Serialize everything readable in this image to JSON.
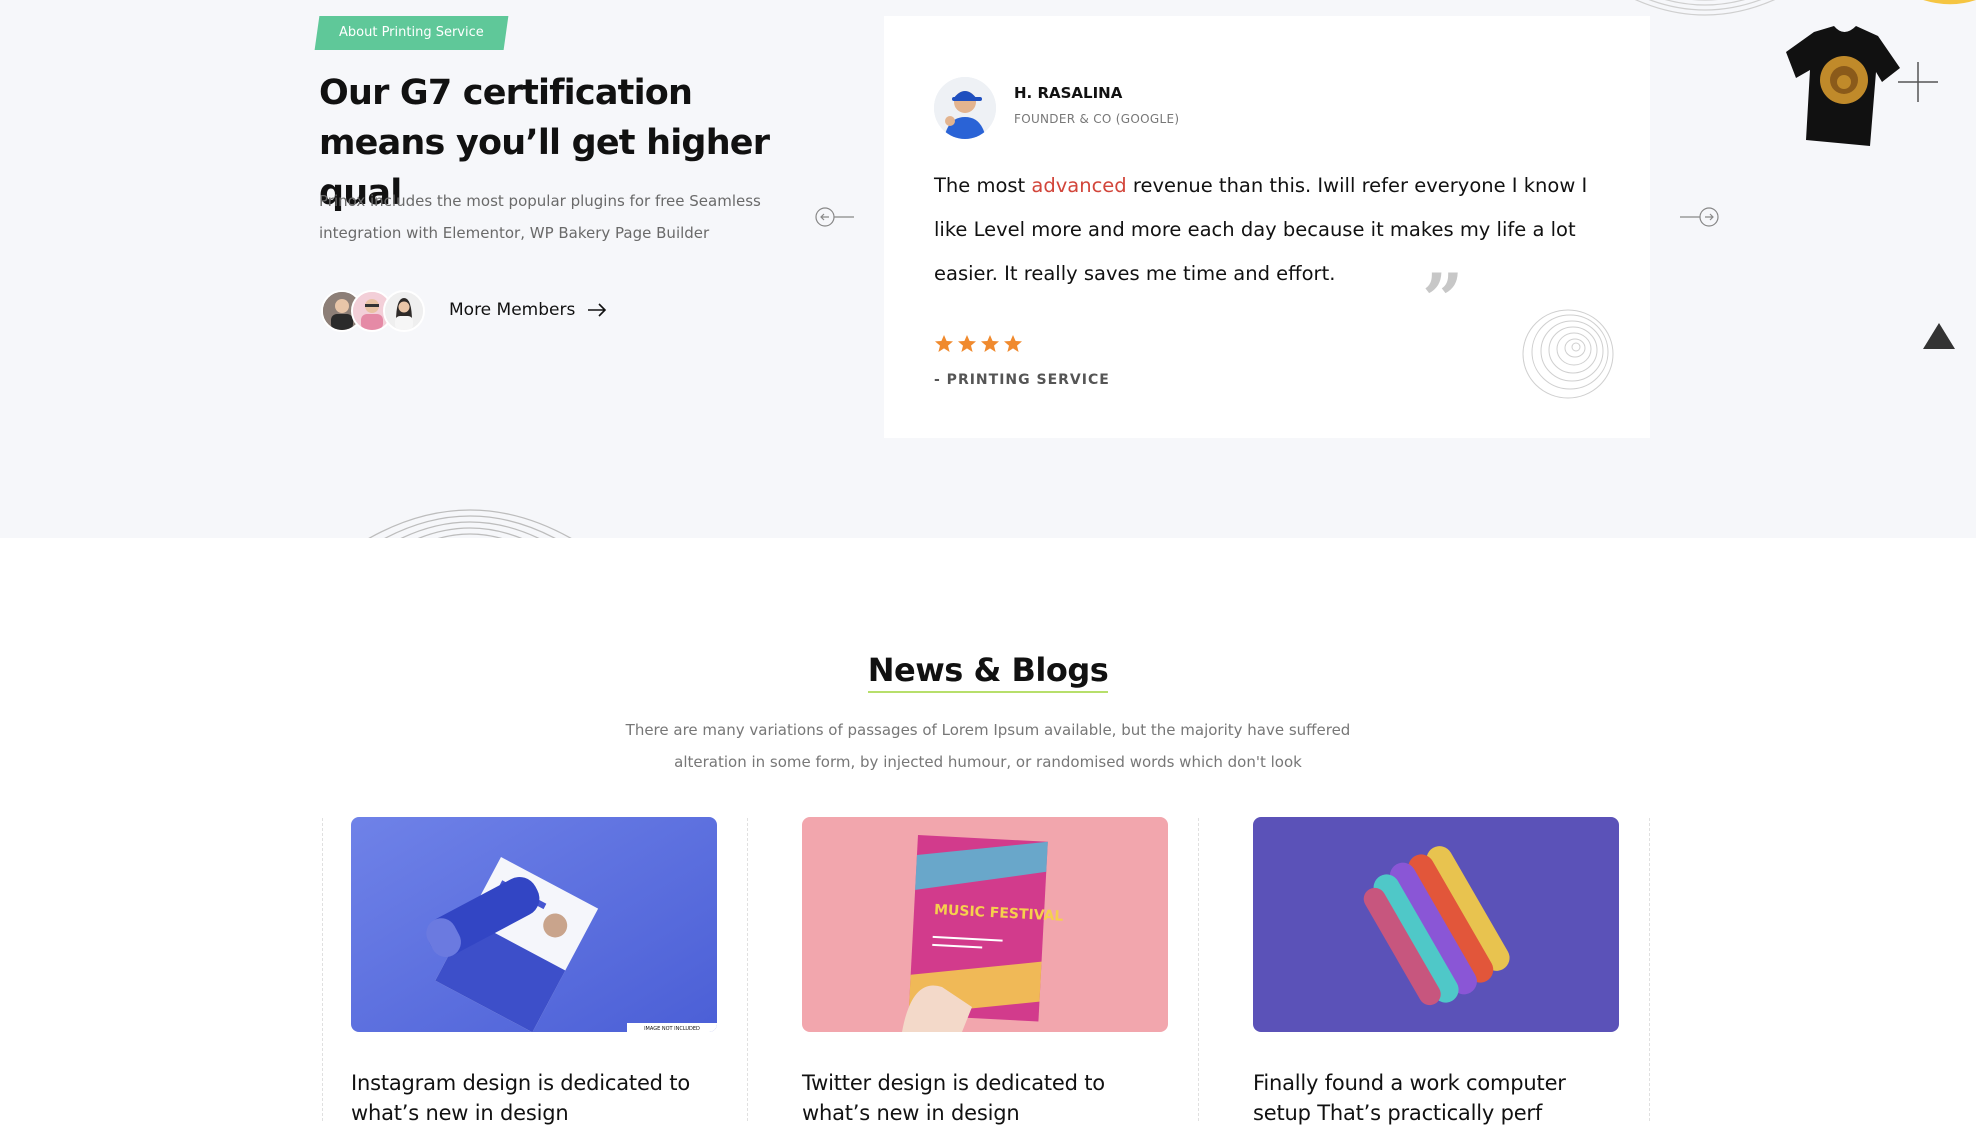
{
  "about": {
    "badge": "About Printing Service",
    "heading": "Our G7 certification means you’ll get higher qual",
    "description": "Prinox includes the most popular plugins for free Seamless integration with Elementor, WP Bakery Page Builder",
    "more_members_label": "More Members"
  },
  "testimonial": {
    "name": "H. RASALINA",
    "role": "FOUNDER & CO (GOOGLE)",
    "quote_before": "The most ",
    "quote_highlight": "advanced",
    "quote_after": " revenue than this. Iwill refer everyone I know I like Level more and more each day because it makes my life a lot easier. It really saves me time and effort.",
    "rating": 4,
    "source": "- PRINTING SERVICE"
  },
  "news": {
    "title": "News & Blogs",
    "description": "There are many variations of passages of Lorem Ipsum available, but the majority have suffered alteration in some form, by injected humour, or randomised words which don't look",
    "posts": [
      {
        "title": "Instagram design is dedicated to what’s new in design",
        "image_alt_text": "IMAGE NOT INCLUDED"
      },
      {
        "title": "Twitter design is dedicated to what’s new in design",
        "image_text": "MUSIC FESTIVAL"
      },
      {
        "title": "Finally found a work computer setup That’s practically perf"
      }
    ]
  },
  "colors": {
    "accent_red": "#d2453a",
    "badge_green": "#5fc899",
    "star_orange": "#f08a2e",
    "band_gray": "#f6f7fa"
  },
  "icons": [
    "arrow-left-icon",
    "arrow-right-icon",
    "right-arrow-icon",
    "quote-icon",
    "star-icon",
    "plus-icon",
    "scroll-top-icon",
    "spiral-decoration"
  ]
}
